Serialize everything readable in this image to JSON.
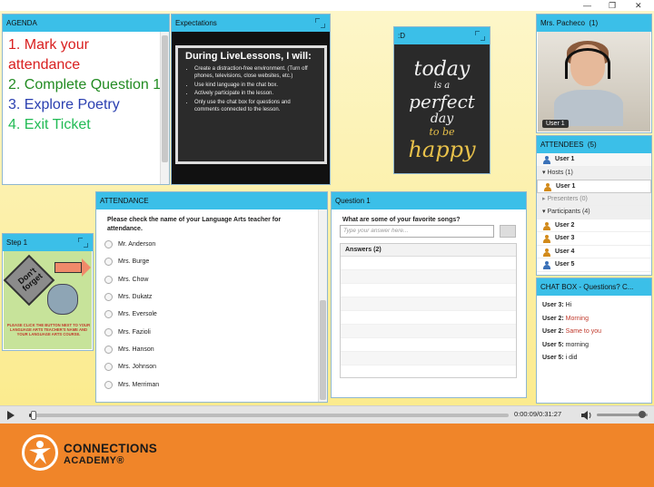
{
  "window": {
    "minimize": "—",
    "restore": "❐",
    "close": "✕"
  },
  "agenda": {
    "title": "AGENDA",
    "items": [
      {
        "text": "1. Mark your attendance",
        "color": "#d92020"
      },
      {
        "text": "2. Complete Question 1",
        "color": "#228b22"
      },
      {
        "text": "3. Explore Poetry",
        "color": "#2a3fb0"
      },
      {
        "text": "4. Exit Ticket",
        "color": "#22bb55"
      }
    ]
  },
  "expectations": {
    "title": "Expectations",
    "heading": "During LiveLessons, I will:",
    "rules": [
      "Create a distraction-free environment. (Turn off phones, televisions, close websites, etc.)",
      "Use kind language in the chat box.",
      "Actively participate in the lesson.",
      "Only use the chat box for questions and comments connected to the lesson."
    ]
  },
  "d_pod": {
    "title": ":D",
    "image_lines": [
      "today",
      "is a",
      "perfect",
      "day",
      "to be",
      "happy"
    ]
  },
  "video_pod": {
    "title": "Mrs. Pacheco",
    "count": "(1)",
    "label": "User 1"
  },
  "attendees": {
    "title": "ATTENDEES",
    "count": "(5)",
    "me": "User 1",
    "hosts_label": "Hosts (1)",
    "host_user": "User 1",
    "presenters_label": "Presenters (0)",
    "participants_label": "Participants (4)",
    "participants": [
      "User 2",
      "User 3",
      "User 4",
      "User 5"
    ]
  },
  "chat": {
    "title": "CHAT BOX - Questions? C...",
    "messages": [
      {
        "user": "User 3:",
        "text": "Hi",
        "color": "#222222"
      },
      {
        "user": "User 2:",
        "text": "Morning",
        "color": "#c0392b"
      },
      {
        "user": "User 2:",
        "text": "Same to you",
        "color": "#c0392b"
      },
      {
        "user": "User 5:",
        "text": "morning",
        "color": "#222222"
      },
      {
        "user": "User 5:",
        "text": "i did",
        "color": "#222222"
      }
    ]
  },
  "step": {
    "title": "Step 1",
    "sign_text": "Don't forget",
    "caption": "PLEASE CLICK THE BUTTON NEXT TO YOUR LANGUAGE ARTS TEACHER'S NAME AND YOUR LANGUAGE ARTS COURSE."
  },
  "attendance": {
    "title": "ATTENDANCE",
    "question": "Please check the name of your Language Arts teacher for attendance.",
    "options": [
      "Mr. Anderson",
      "Mrs. Burge",
      "Mrs. Chow",
      "Mrs. Dukatz",
      "Mrs. Eversole",
      "Mrs. Fazioli",
      "Mrs. Hanson",
      "Mrs. Johnson",
      "Mrs. Merriman"
    ]
  },
  "question1": {
    "title": "Question 1",
    "prompt": "What are some of your favorite songs?",
    "input_placeholder": "Type your answer here...",
    "answers_label": "Answers (2)"
  },
  "player": {
    "time": "0:00:09/0:31:27",
    "progress": 0.005,
    "volume": 0.9
  },
  "brand": {
    "line1": "CONNECTIONS",
    "line2": "ACADEMY®"
  }
}
